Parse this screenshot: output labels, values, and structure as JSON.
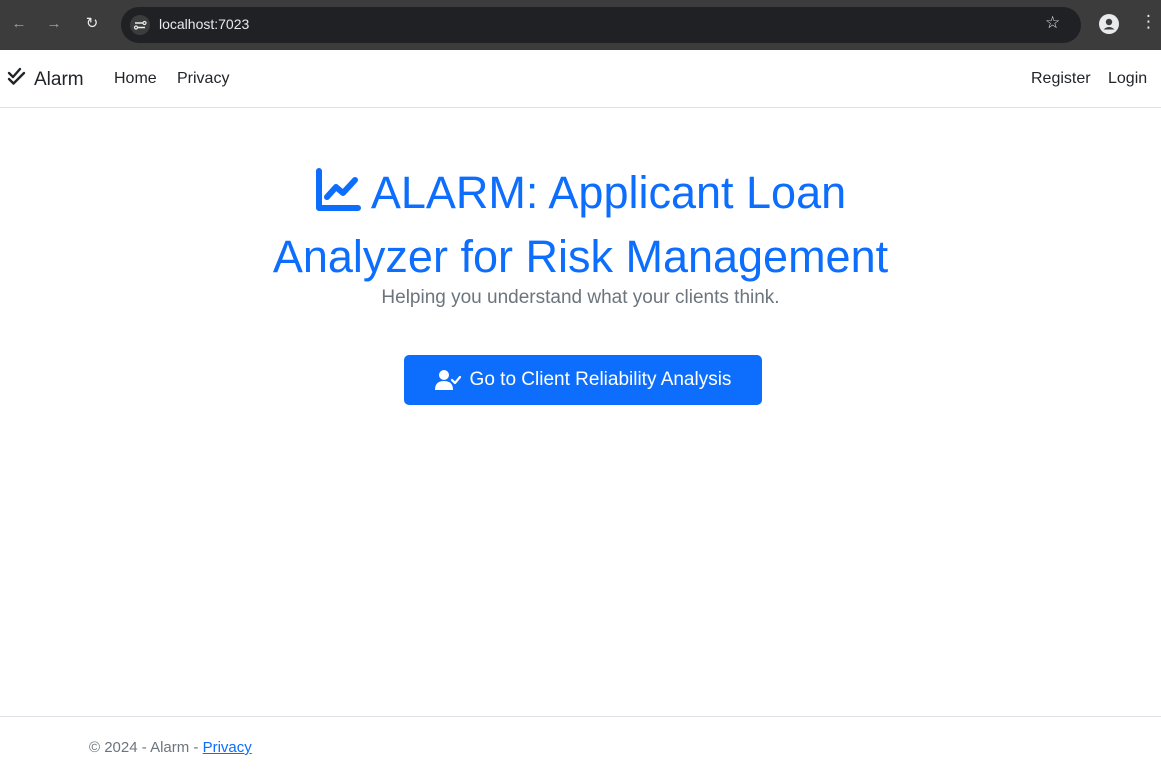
{
  "browser": {
    "url": "localhost:7023",
    "icons": [
      "back-arrow-icon",
      "forward-arrow-icon",
      "reload-icon",
      "site-settings-icon",
      "star-icon",
      "profile-icon",
      "menu-kebab-icon"
    ]
  },
  "navbar": {
    "brand": "Alarm",
    "brand_icon": "double-check-icon",
    "links": [
      "Home",
      "Privacy"
    ],
    "right_links": [
      "Register",
      "Login"
    ]
  },
  "hero": {
    "title_line1": "ALARM: Applicant Loan",
    "title_line2": "Analyzer for Risk Management",
    "title_icon": "line-chart-icon",
    "subtitle": "Helping you understand what your clients think.",
    "button_label": "Go to Client Reliability Analysis",
    "button_icon": "user-check-icon"
  },
  "footer": {
    "text": "© 2024 - Alarm - ",
    "link": "Privacy"
  },
  "colors": {
    "primary": "#0d6efd",
    "muted": "#6c757d",
    "text": "#212529",
    "chrome": "#3c3c3c"
  }
}
